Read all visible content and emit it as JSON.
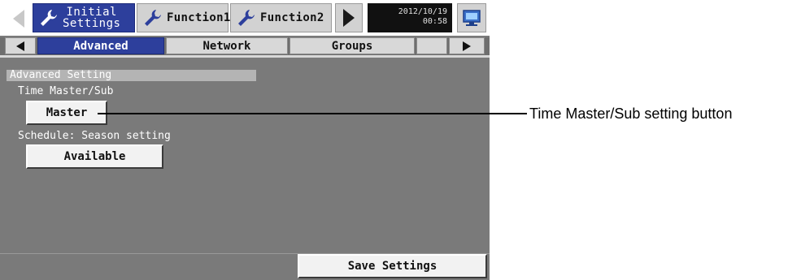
{
  "topbar": {
    "tabs": [
      {
        "label": "Initial\nSettings",
        "icon": "wrench-icon",
        "active": true
      },
      {
        "label": "Function1",
        "icon": "wrench-icon",
        "active": false
      },
      {
        "label": "Function2",
        "icon": "wrench-icon",
        "active": false
      }
    ],
    "date": "2012/10/19",
    "time": "00:58",
    "prev_icon": "triangle-left-icon",
    "next_icon": "triangle-right-icon",
    "monitor_icon": "monitor-icon"
  },
  "subtabs": {
    "items": [
      "Advanced",
      "Network",
      "Groups",
      ""
    ],
    "active": "Advanced",
    "prev_icon": "triangle-left-icon",
    "next_icon": "triangle-right-icon"
  },
  "content": {
    "section_title": "Advanced Setting",
    "time_master": {
      "label": "Time Master/Sub",
      "value": "Master"
    },
    "season": {
      "label": "Schedule: Season setting",
      "value": "Available"
    },
    "save_label": "Save Settings"
  },
  "callout": {
    "text": "Time Master/Sub setting button"
  },
  "colors": {
    "active_tab": "#2d3f9c",
    "background": "#7a7a7a",
    "button": "#f2f2f2"
  }
}
